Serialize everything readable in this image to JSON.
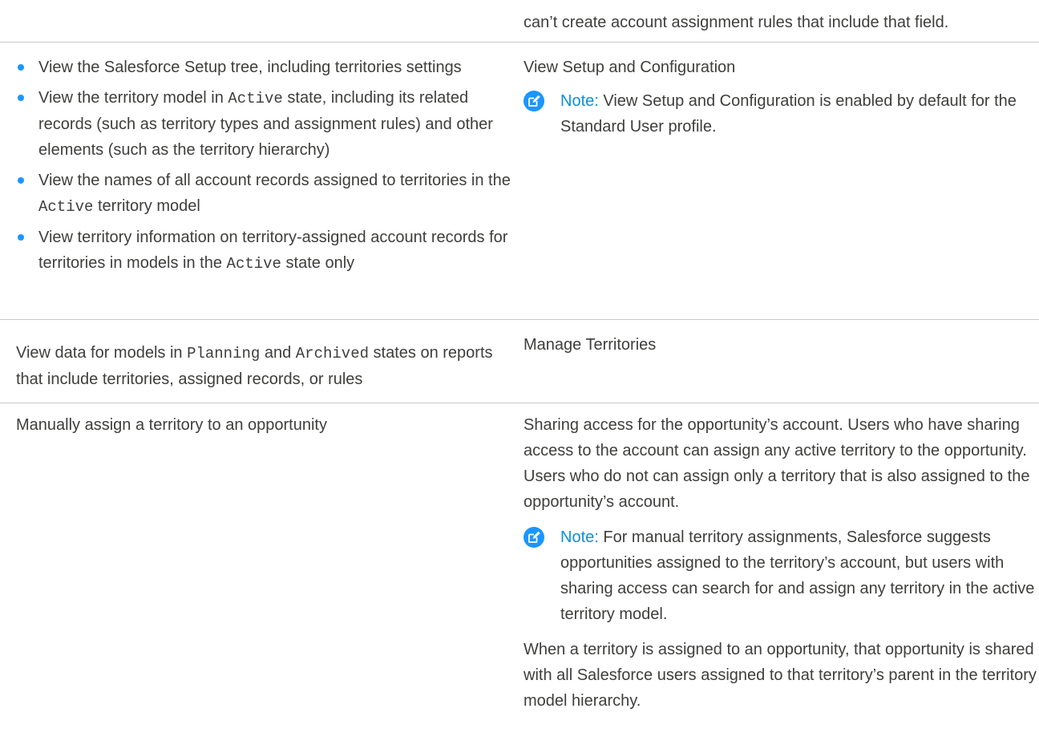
{
  "top_fragment": "can’t create account assignment rules that include that field.",
  "rows": [
    {
      "bullets": [
        {
          "parts": [
            {
              "t": "View the Salesforce Setup tree, including territories settings"
            }
          ]
        },
        {
          "parts": [
            {
              "t": "View the territory model in "
            },
            {
              "t": "Active",
              "mono": true
            },
            {
              "t": " state, including its related records (such as territory types and assignment rules) and other elements (such as the territory hierarchy)"
            }
          ]
        },
        {
          "parts": [
            {
              "t": "View the names of all account records assigned to territories in the "
            },
            {
              "t": "Active",
              "mono": true
            },
            {
              "t": " territory model"
            }
          ]
        },
        {
          "parts": [
            {
              "t": "View territory information on territory-assigned account records for territories in models in the "
            },
            {
              "t": "Active",
              "mono": true
            },
            {
              "t": " state only"
            }
          ]
        }
      ],
      "permission": "View Setup and Configuration",
      "note_label": "Note:",
      "note_text": "View Setup and Configuration is enabled by default for the Standard User profile."
    },
    {
      "task_prefix": "View data for models in ",
      "task_mono_1": "Planning",
      "task_mid": " and ",
      "task_mono_2": "Archived",
      "task_suffix": " states on reports that include territories, assigned records, or rules",
      "permission": "Manage Territories"
    },
    {
      "task": "Manually assign a territory to an opportunity",
      "paragraph_1": "Sharing access for the opportunity’s account. Users who have sharing access to the account can assign any active territory to the opportunity. Users who do not can assign only a territory that is also assigned to the opportunity’s account.",
      "note_label": "Note:",
      "note_text": "For manual territory assignments, Salesforce suggests opportunities assigned to the territory’s account, but users with sharing access can search for and assign any territory in the active territory model.",
      "paragraph_2": "When a territory is assigned to an opportunity, that opportunity is shared with all Salesforce users assigned to that territory’s parent in the territory model hierarchy."
    }
  ],
  "colors": {
    "bullet": "#1b96ff",
    "note_accent": "#0a8fdc",
    "divider": "#c9c9c9",
    "text": "#3e3e3c"
  },
  "icons": {
    "note": "note-edit-icon"
  }
}
